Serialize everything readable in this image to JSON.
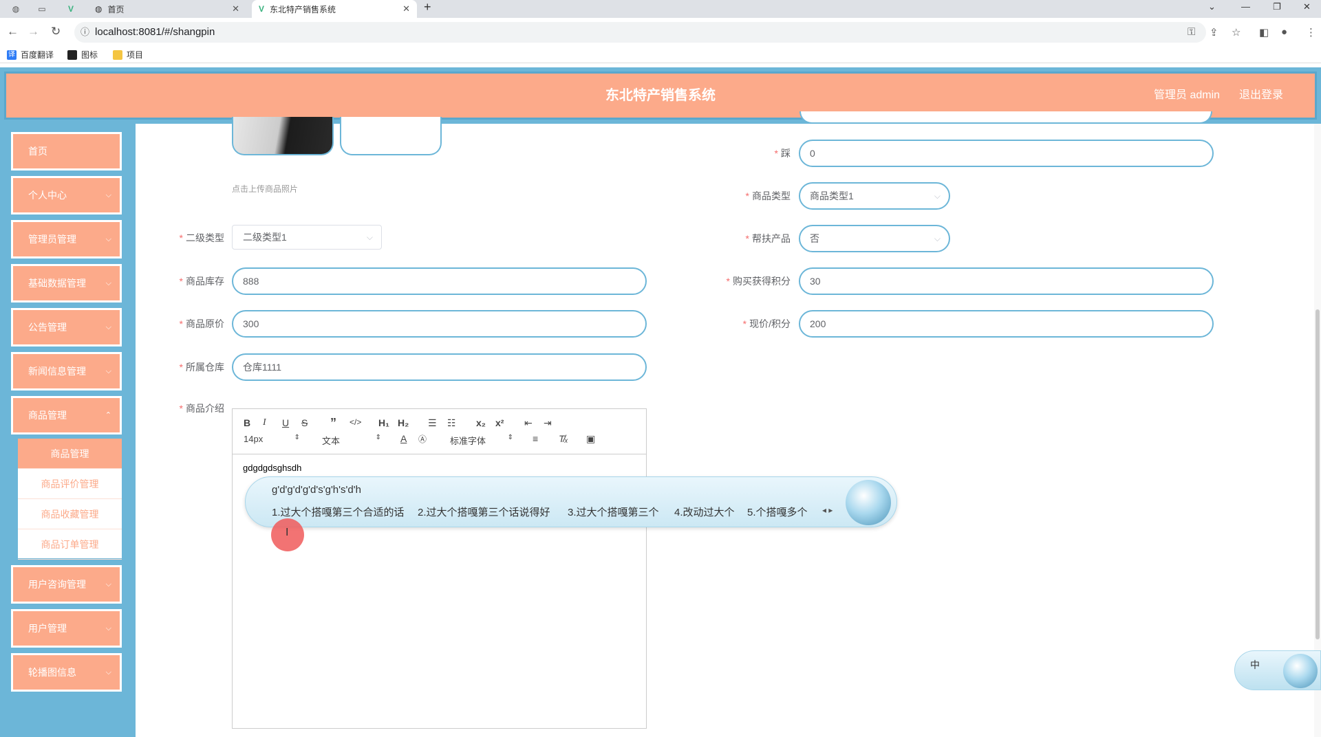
{
  "browser": {
    "tabs": [
      {
        "title": "首页",
        "active": false
      },
      {
        "title": "东北特产销售系统",
        "active": true
      }
    ],
    "url": "localhost:8081/#/shangpin",
    "bookmarks": [
      "百度翻译",
      "图标",
      "项目"
    ]
  },
  "header": {
    "title": "东北特产销售系统",
    "user": "管理员 admin",
    "logout": "退出登录"
  },
  "sidebar": {
    "items": [
      "首页",
      "个人中心",
      "管理员管理",
      "基础数据管理",
      "公告管理",
      "新闻信息管理",
      "商品管理",
      "用户咨询管理",
      "用户管理",
      "轮播图信息"
    ],
    "submenu": [
      "商品管理",
      "商品评价管理",
      "商品收藏管理",
      "商品订单管理"
    ]
  },
  "form": {
    "upload_hint": "点击上传商品照片",
    "labels": {
      "cai": "踩",
      "type": "商品类型",
      "subtype": "二级类型",
      "help": "帮扶产品",
      "stock": "商品库存",
      "points": "购买获得积分",
      "price": "商品原价",
      "now_price": "现价/积分",
      "warehouse": "所属仓库",
      "intro": "商品介绍"
    },
    "values": {
      "cai": "0",
      "type": "商品类型1",
      "subtype": "二级类型1",
      "help": "否",
      "stock": "888",
      "points": "30",
      "price": "300",
      "now_price": "200",
      "warehouse": "仓库1111"
    }
  },
  "editor": {
    "font_size": "14px",
    "text_style": "文本",
    "font_family": "标准字体",
    "content": "gdgdgdsghsdh"
  },
  "ime": {
    "composition": "g'd'g'd'g'd's'g'h's'd'h",
    "candidates": [
      "1.过大个搭嘎第三个合适的话",
      "2.过大个搭嘎第三个话说得好",
      "3.过大个搭嘎第三个",
      "4.改动过大个",
      "5.个搭嘎多个"
    ],
    "status": "中"
  }
}
